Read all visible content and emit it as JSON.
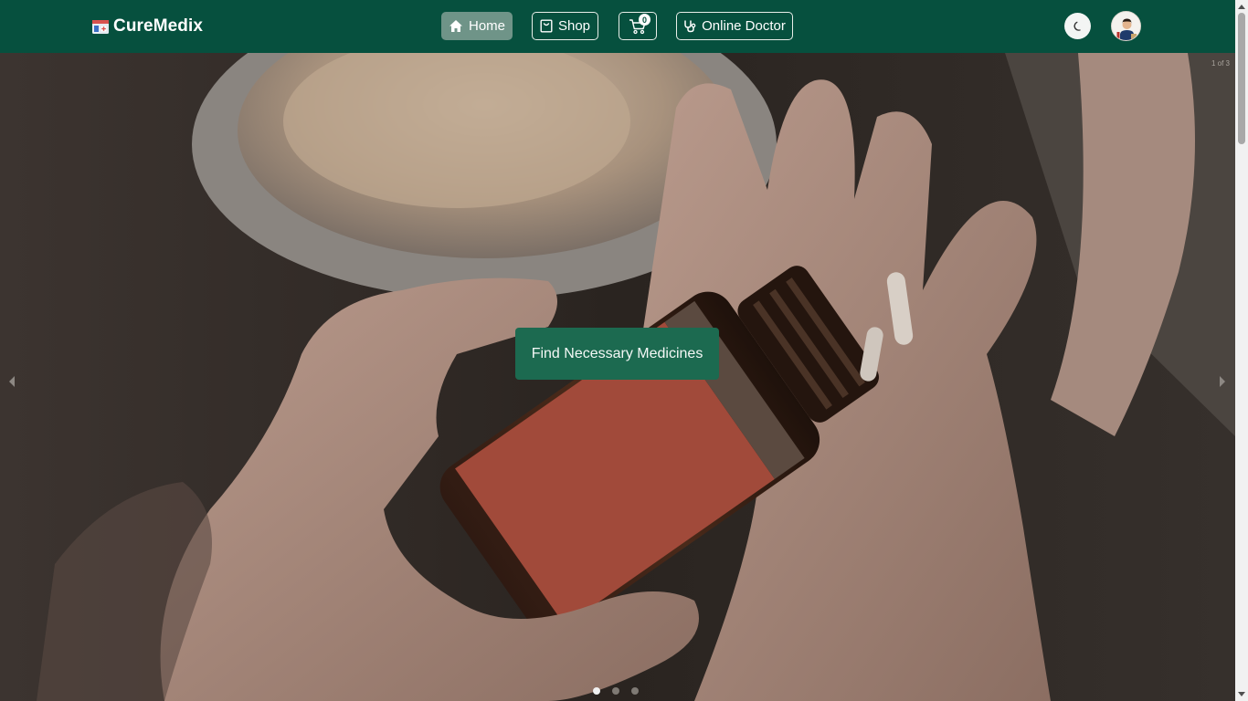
{
  "brand": {
    "name": "CureMedix",
    "logo_icon": "medicine-cabinet-icon"
  },
  "nav": {
    "home": {
      "label": "Home",
      "icon": "home-icon",
      "active": true
    },
    "shop": {
      "label": "Shop",
      "icon": "shopping-bag-icon"
    },
    "cart": {
      "icon": "cart-icon",
      "count": "0"
    },
    "doctor": {
      "label": "Online Doctor",
      "icon": "stethoscope-icon"
    },
    "theme_toggle": {
      "icon": "moon-icon"
    },
    "avatar": {
      "icon": "user-avatar-icon"
    }
  },
  "hero": {
    "slide_counter": "1 of 3",
    "cta_label": "Find Necessary Medicines",
    "dots": [
      {
        "active": true
      },
      {
        "active": false
      },
      {
        "active": false
      }
    ]
  },
  "colors": {
    "navbar": "#06503e",
    "active_nav": "#6f9488",
    "cta": "#1c6a50"
  }
}
